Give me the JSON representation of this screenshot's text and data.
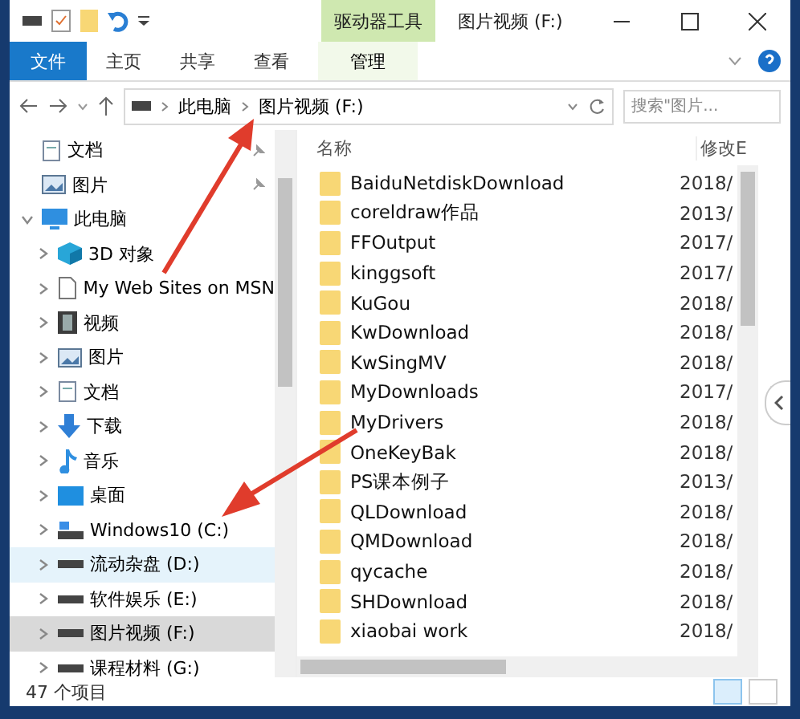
{
  "window": {
    "title": "图片视频 (F:)",
    "context_tab": "驱动器工具"
  },
  "ribbon_tabs": [
    {
      "label": "文件",
      "kind": "file",
      "selected": false
    },
    {
      "label": "主页",
      "kind": "tab",
      "selected": false
    },
    {
      "label": "共享",
      "kind": "tab",
      "selected": false
    },
    {
      "label": "查看",
      "kind": "tab",
      "selected": false
    },
    {
      "label": "管理",
      "kind": "context",
      "selected": false
    }
  ],
  "address": {
    "crumbs": [
      "此电脑",
      "图片视频 (F:)"
    ]
  },
  "search": {
    "placeholder": "搜索\"图片..."
  },
  "nav": [
    {
      "label": "文档",
      "kind": "doc",
      "pinned": true,
      "selected": false,
      "hover": false
    },
    {
      "label": "图片",
      "kind": "pic",
      "pinned": true,
      "selected": false,
      "hover": false
    },
    {
      "label": "此电脑",
      "kind": "pc",
      "expanded": true,
      "selected": false,
      "hover": false,
      "children": [
        {
          "label": "3D 对象",
          "kind": "cube",
          "expanded": false,
          "selected": false,
          "hover": false
        },
        {
          "label": "My Web Sites on MSN",
          "kind": "page",
          "expanded": false,
          "selected": false,
          "hover": false
        },
        {
          "label": "视频",
          "kind": "video",
          "expanded": false,
          "selected": false,
          "hover": false
        },
        {
          "label": "图片",
          "kind": "pic",
          "expanded": false,
          "selected": false,
          "hover": false
        },
        {
          "label": "文档",
          "kind": "doc",
          "expanded": false,
          "selected": false,
          "hover": false
        },
        {
          "label": "下载",
          "kind": "down",
          "expanded": false,
          "selected": false,
          "hover": false
        },
        {
          "label": "音乐",
          "kind": "music",
          "expanded": false,
          "selected": false,
          "hover": false
        },
        {
          "label": "桌面",
          "kind": "desk",
          "expanded": false,
          "selected": false,
          "hover": false
        },
        {
          "label": "Windows10 (C:)",
          "kind": "sysdrive",
          "expanded": false,
          "selected": false,
          "hover": false
        },
        {
          "label": "流动杂盘 (D:)",
          "kind": "drive",
          "expanded": false,
          "selected": false,
          "hover": true
        },
        {
          "label": "软件娱乐 (E:)",
          "kind": "drive",
          "expanded": false,
          "selected": false,
          "hover": false
        },
        {
          "label": "图片视频 (F:)",
          "kind": "drive",
          "expanded": false,
          "selected": true,
          "hover": false
        },
        {
          "label": "课程材料 (G:)",
          "kind": "drive",
          "expanded": false,
          "selected": false,
          "hover": false
        }
      ]
    }
  ],
  "columns": [
    "名称",
    "修改E"
  ],
  "files": [
    {
      "name": "BaiduNetdiskDownload",
      "date": "2018/"
    },
    {
      "name": "coreldraw作品",
      "date": "2013/"
    },
    {
      "name": "FFOutput",
      "date": "2017/"
    },
    {
      "name": "kinggsoft",
      "date": "2017/"
    },
    {
      "name": "KuGou",
      "date": "2018/"
    },
    {
      "name": "KwDownload",
      "date": "2018/"
    },
    {
      "name": "KwSingMV",
      "date": "2018/"
    },
    {
      "name": "MyDownloads",
      "date": "2017/"
    },
    {
      "name": "MyDrivers",
      "date": "2018/"
    },
    {
      "name": "OneKeyBak",
      "date": "2018/"
    },
    {
      "name": "PS课本例子",
      "date": "2013/"
    },
    {
      "name": "QLDownload",
      "date": "2018/"
    },
    {
      "name": "QMDownload",
      "date": "2018/"
    },
    {
      "name": "qycache",
      "date": "2018/"
    },
    {
      "name": "SHDownload",
      "date": "2018/"
    },
    {
      "name": "xiaobai work",
      "date": "2018/"
    }
  ],
  "status": {
    "count": "47 个项目"
  }
}
